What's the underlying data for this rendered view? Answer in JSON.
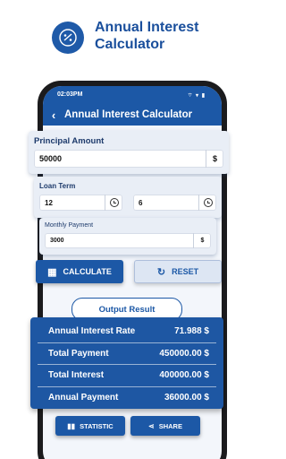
{
  "header": {
    "title_line1": "Annual Interest",
    "title_line2": "Calculator"
  },
  "status": {
    "time": "02:03PM",
    "icons": "⌔ ▾ ▮"
  },
  "appbar": {
    "back": "‹",
    "title": "Annual Interest Calculator"
  },
  "principal": {
    "label": "Principal Amount",
    "value": "50000",
    "unit": "$"
  },
  "loan_term": {
    "label": "Loan Term",
    "years": "12",
    "months": "6"
  },
  "monthly": {
    "label": "Monthly Payment",
    "value": "3000",
    "unit": "$"
  },
  "buttons": {
    "calculate": "CALCULATE",
    "reset": "RESET",
    "statistic": "STATISTIC",
    "share": "SHARE"
  },
  "output": {
    "title": "Output Result",
    "rows": [
      {
        "label": "Annual Interest Rate",
        "value": "71.988 $"
      },
      {
        "label": "Total Payment",
        "value": "450000.00 $"
      },
      {
        "label": "Total Interest",
        "value": "400000.00 $"
      },
      {
        "label": "Annual Payment",
        "value": "36000.00 $"
      }
    ]
  },
  "colors": {
    "primary": "#1c58a6",
    "card_bg": "#e9eef6",
    "dark_text": "#1d3a6b"
  }
}
